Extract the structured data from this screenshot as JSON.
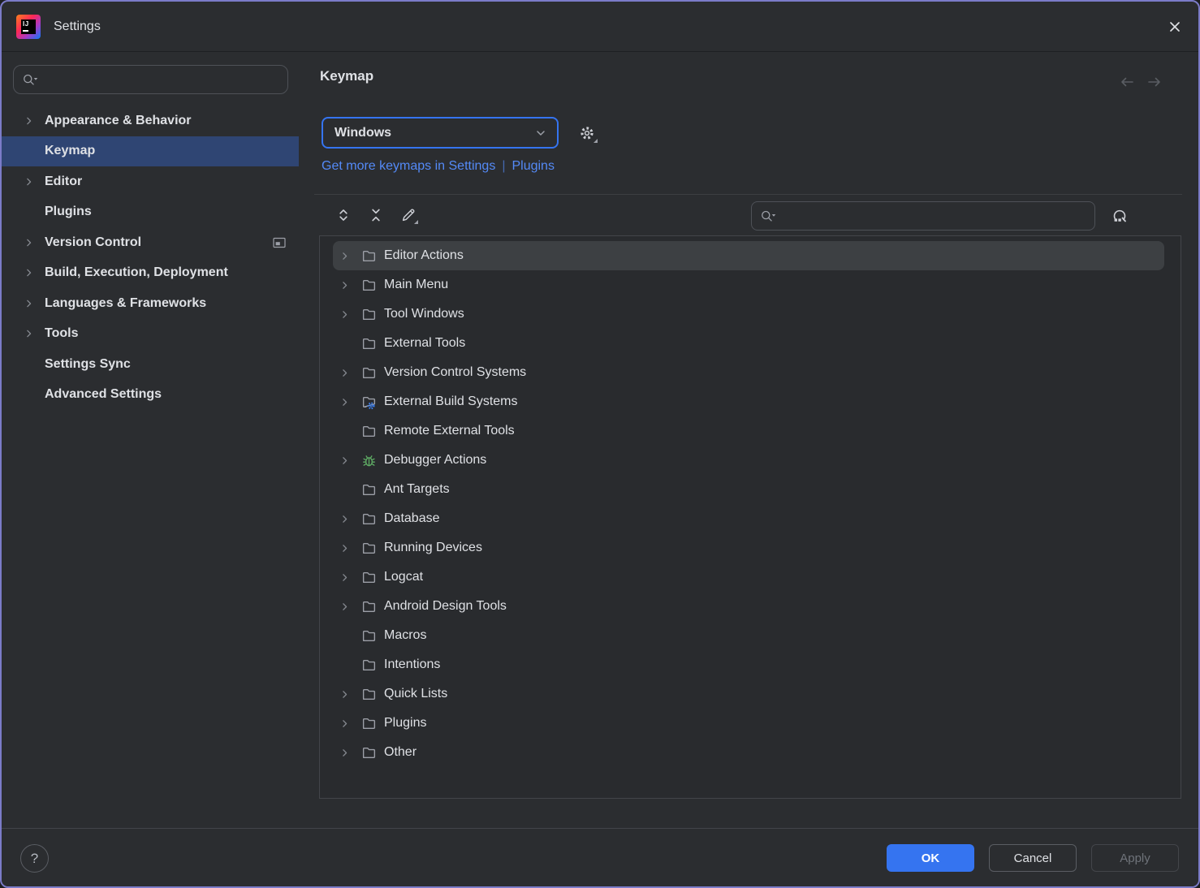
{
  "window": {
    "title": "Settings"
  },
  "sidebar": {
    "search": {
      "value": "",
      "placeholder": ""
    },
    "items": [
      {
        "label": "Appearance & Behavior",
        "chevron": true,
        "selected": false,
        "trailing_icon": null
      },
      {
        "label": "Keymap",
        "chevron": false,
        "selected": true,
        "trailing_icon": null
      },
      {
        "label": "Editor",
        "chevron": true,
        "selected": false,
        "trailing_icon": null
      },
      {
        "label": "Plugins",
        "chevron": false,
        "selected": false,
        "trailing_icon": null
      },
      {
        "label": "Version Control",
        "chevron": true,
        "selected": false,
        "trailing_icon": "screen-icon"
      },
      {
        "label": "Build, Execution, Deployment",
        "chevron": true,
        "selected": false,
        "trailing_icon": null
      },
      {
        "label": "Languages & Frameworks",
        "chevron": true,
        "selected": false,
        "trailing_icon": null
      },
      {
        "label": "Tools",
        "chevron": true,
        "selected": false,
        "trailing_icon": null
      },
      {
        "label": "Settings Sync",
        "chevron": false,
        "selected": false,
        "trailing_icon": null
      },
      {
        "label": "Advanced Settings",
        "chevron": false,
        "selected": false,
        "trailing_icon": null
      }
    ]
  },
  "content": {
    "page_title": "Keymap",
    "keymap_dropdown": {
      "value": "Windows"
    },
    "links": {
      "get_more": "Get more keymaps in Settings",
      "separator": "|",
      "plugins": "Plugins"
    },
    "action_search": {
      "value": "",
      "placeholder": ""
    },
    "tree": [
      {
        "label": "Editor Actions",
        "chevron": true,
        "icon": "folder",
        "hovered": true
      },
      {
        "label": "Main Menu",
        "chevron": true,
        "icon": "folder",
        "hovered": false
      },
      {
        "label": "Tool Windows",
        "chevron": true,
        "icon": "folder",
        "hovered": false
      },
      {
        "label": "External Tools",
        "chevron": false,
        "icon": "folder",
        "hovered": false
      },
      {
        "label": "Version Control Systems",
        "chevron": true,
        "icon": "folder",
        "hovered": false
      },
      {
        "label": "External Build Systems",
        "chevron": true,
        "icon": "folder-gear",
        "hovered": false
      },
      {
        "label": "Remote External Tools",
        "chevron": false,
        "icon": "folder",
        "hovered": false
      },
      {
        "label": "Debugger Actions",
        "chevron": true,
        "icon": "bug",
        "hovered": false
      },
      {
        "label": "Ant Targets",
        "chevron": false,
        "icon": "folder",
        "hovered": false
      },
      {
        "label": "Database",
        "chevron": true,
        "icon": "folder",
        "hovered": false
      },
      {
        "label": "Running Devices",
        "chevron": true,
        "icon": "folder",
        "hovered": false
      },
      {
        "label": "Logcat",
        "chevron": true,
        "icon": "folder",
        "hovered": false
      },
      {
        "label": "Android Design Tools",
        "chevron": true,
        "icon": "folder",
        "hovered": false
      },
      {
        "label": "Macros",
        "chevron": false,
        "icon": "folder",
        "hovered": false
      },
      {
        "label": "Intentions",
        "chevron": false,
        "icon": "folder",
        "hovered": false
      },
      {
        "label": "Quick Lists",
        "chevron": true,
        "icon": "folder",
        "hovered": false
      },
      {
        "label": "Plugins",
        "chevron": true,
        "icon": "folder",
        "hovered": false
      },
      {
        "label": "Other",
        "chevron": true,
        "icon": "folder",
        "hovered": false
      }
    ]
  },
  "footer": {
    "help": "?",
    "ok": "OK",
    "cancel": "Cancel",
    "apply": "Apply",
    "apply_enabled": false
  },
  "icons": {
    "search-icon": "magnifier-with-caret",
    "expand-all-icon": "chevrons-apart",
    "collapse-all-icon": "chevrons-together",
    "edit-icon": "pencil-with-menu",
    "gear-icon": "gear-with-menu",
    "find-by-shortcut-icon": "magnifier-with-keys",
    "screen-icon": "monitor",
    "bug-icon": "green-bug",
    "folder-icon": "outline-folder"
  },
  "colors": {
    "accent": "#3574F0",
    "link": "#548AF7",
    "sidebar_selection": "#2F4573",
    "tree_hover": "#3D4043",
    "bug_green": "#5FAD65",
    "window_border": "#7B7BC8",
    "background": "#2B2D30"
  }
}
